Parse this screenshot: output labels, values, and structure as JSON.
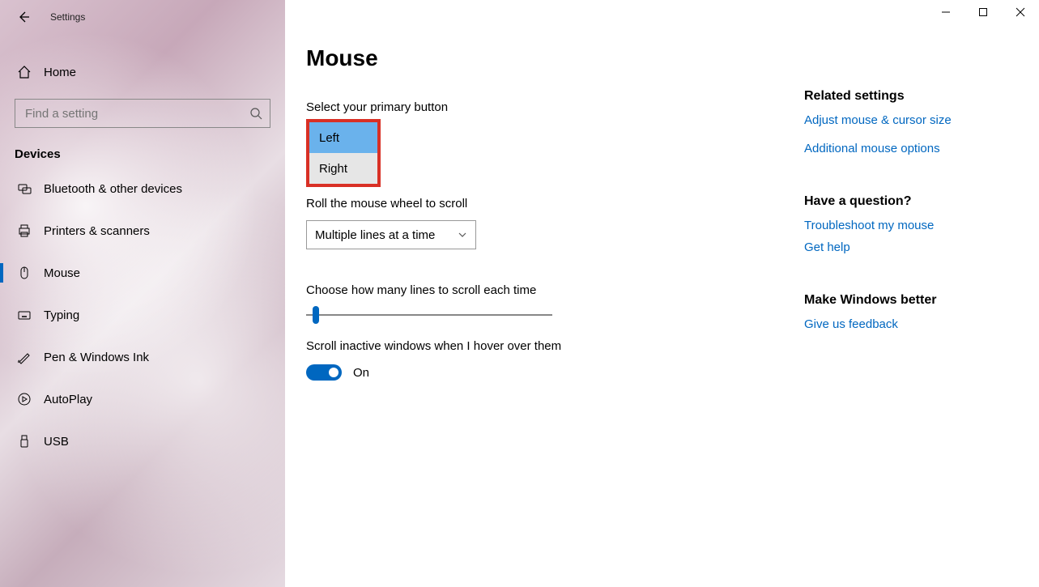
{
  "app_title": "Settings",
  "home_label": "Home",
  "search_placeholder": "Find a setting",
  "section_header": "Devices",
  "nav": [
    {
      "label": "Bluetooth & other devices"
    },
    {
      "label": "Printers & scanners"
    },
    {
      "label": "Mouse"
    },
    {
      "label": "Typing"
    },
    {
      "label": "Pen & Windows Ink"
    },
    {
      "label": "AutoPlay"
    },
    {
      "label": "USB"
    }
  ],
  "page_title": "Mouse",
  "primary_button_label": "Select your primary button",
  "primary_button_options": {
    "left": "Left",
    "right": "Right"
  },
  "scroll_wheel_label": "Roll the mouse wheel to scroll",
  "scroll_wheel_value": "Multiple lines at a time",
  "lines_label": "Choose how many lines to scroll each time",
  "inactive_label": "Scroll inactive windows when I hover over them",
  "toggle_state": "On",
  "right": {
    "related_head": "Related settings",
    "link1": "Adjust mouse & cursor size",
    "link2": "Additional mouse options",
    "question_head": "Have a question?",
    "link3": "Troubleshoot my mouse",
    "link4": "Get help",
    "better_head": "Make Windows better",
    "link5": "Give us feedback"
  }
}
